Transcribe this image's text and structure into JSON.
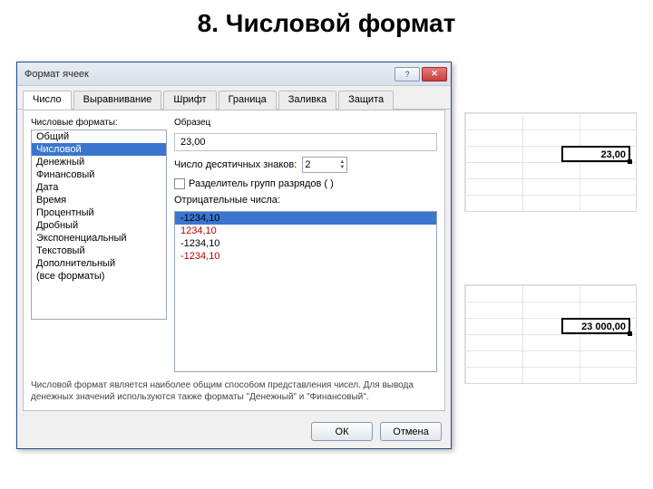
{
  "slide_title": "8. Числовой формат",
  "dialog": {
    "title": "Формат ячеек",
    "help_icon": "?",
    "close_icon": "✕",
    "tabs": {
      "number": "Число",
      "alignment": "Выравнивание",
      "font": "Шрифт",
      "border": "Граница",
      "fill": "Заливка",
      "protection": "Защита"
    },
    "category_label": "Числовые форматы:",
    "categories": [
      "Общий",
      "Числовой",
      "Денежный",
      "Финансовый",
      "Дата",
      "Время",
      "Процентный",
      "Дробный",
      "Экспоненциальный",
      "Текстовый",
      "Дополнительный",
      "(все форматы)"
    ],
    "selected_category_index": 1,
    "sample_label": "Образец",
    "sample_value": "23,00",
    "decimals_label": "Число десятичных знаков:",
    "decimals_value": "2",
    "thousands_label": "Разделитель групп разрядов ( )",
    "neg_label": "Отрицательные числа:",
    "neg_items": [
      {
        "text": "-1234,10",
        "red": false,
        "selected": true
      },
      {
        "text": "1234,10",
        "red": true,
        "selected": false
      },
      {
        "text": "-1234,10",
        "red": false,
        "selected": false
      },
      {
        "text": "-1234,10",
        "red": true,
        "selected": false
      }
    ],
    "desc": "Числовой формат является наиболее общим способом представления чисел. Для вывода денежных значений используются также форматы \"Денежный\" и \"Финансовый\".",
    "ok": "ОК",
    "cancel": "Отмена"
  },
  "cells": {
    "top_value": "23,00",
    "bottom_value": "23 000,00"
  }
}
